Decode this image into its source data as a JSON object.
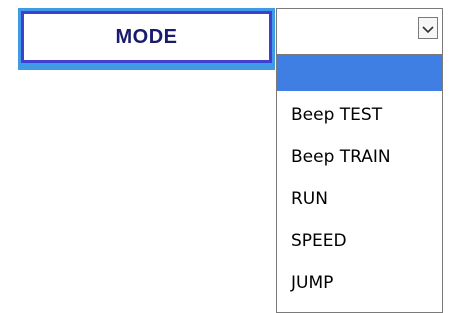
{
  "mode_button": {
    "label": "MODE"
  },
  "select": {
    "current_value": "",
    "icon": "chevron-down-icon",
    "options": [
      "",
      "Beep TEST",
      "Beep TRAIN",
      "RUN",
      "SPEED",
      "JUMP"
    ],
    "selected_index": 0
  },
  "colors": {
    "accent_blue": "#3f9be6",
    "border_blue": "#3f3fd0",
    "label_text": "#1a1a6e",
    "highlight": "#3f7fe3"
  }
}
